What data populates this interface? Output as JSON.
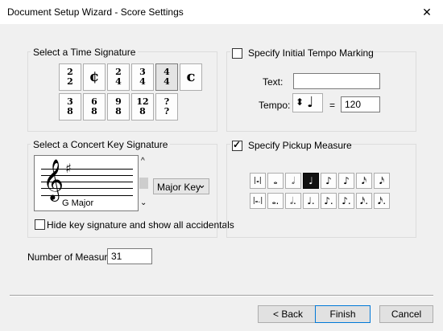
{
  "window": {
    "title": "Document Setup Wizard - Score Settings",
    "close_glyph": "✕"
  },
  "time_signature": {
    "label": "Select a Time Signature",
    "row1": [
      {
        "top": "2",
        "bottom": "2",
        "symbol": null,
        "name": "time-sig-2-2-button"
      },
      {
        "top": null,
        "bottom": null,
        "symbol": "¢",
        "name": "time-sig-cut-time-button"
      },
      {
        "top": "2",
        "bottom": "4",
        "symbol": null,
        "name": "time-sig-2-4-button"
      },
      {
        "top": "3",
        "bottom": "4",
        "symbol": null,
        "name": "time-sig-3-4-button"
      },
      {
        "top": "4",
        "bottom": "4",
        "symbol": null,
        "name": "time-sig-4-4-button",
        "selected": true
      },
      {
        "top": null,
        "bottom": null,
        "symbol": "c",
        "name": "time-sig-common-time-button"
      }
    ],
    "row2": [
      {
        "top": "3",
        "bottom": "8",
        "name": "time-sig-3-8-button"
      },
      {
        "top": "6",
        "bottom": "8",
        "name": "time-sig-6-8-button"
      },
      {
        "top": "9",
        "bottom": "8",
        "name": "time-sig-9-8-button"
      },
      {
        "top": "12",
        "bottom": "8",
        "name": "time-sig-12-8-button"
      },
      {
        "top": "?",
        "bottom": "?",
        "name": "time-sig-other-button"
      }
    ]
  },
  "tempo": {
    "checkbox_label": "Specify Initial Tempo Marking",
    "checked": false,
    "text_label": "Text:",
    "text_value": "",
    "tempo_label": "Tempo:",
    "equals": "=",
    "tempo_value": "120",
    "note_glyph": "♩",
    "arrow_glyph": "⬍"
  },
  "key_signature": {
    "label": "Select a Concert Key Signature",
    "key_name": "G Major",
    "mode_value": "Major Key",
    "dropdown_glyph": "⌄",
    "scroll_up": "^",
    "scroll_down": "⌄",
    "clef_glyph": "𝄞",
    "sharp_glyph": "♯",
    "hide_checkbox_label": "Hide key signature and show all accidentals",
    "hide_checked": false
  },
  "pickup": {
    "checkbox_label": "Specify Pickup Measure",
    "checked": true,
    "row1": [
      "|𝅝|",
      "𝅝",
      "𝅗𝅥",
      "♩",
      "♪",
      "♪",
      "𝅘𝅥𝅯",
      "𝅘𝅥𝅯"
    ],
    "row2": [
      "|𝅝.|",
      "𝅝.",
      "𝅗𝅥.",
      "♩.",
      "♪.",
      "♪.",
      "𝅘𝅥𝅯.",
      "𝅘𝅥𝅯."
    ],
    "selected_index_row1": 3
  },
  "measures": {
    "label": "Number of Measures:",
    "value": "31"
  },
  "footer": {
    "back": "< Back",
    "finish": "Finish",
    "cancel": "Cancel"
  }
}
